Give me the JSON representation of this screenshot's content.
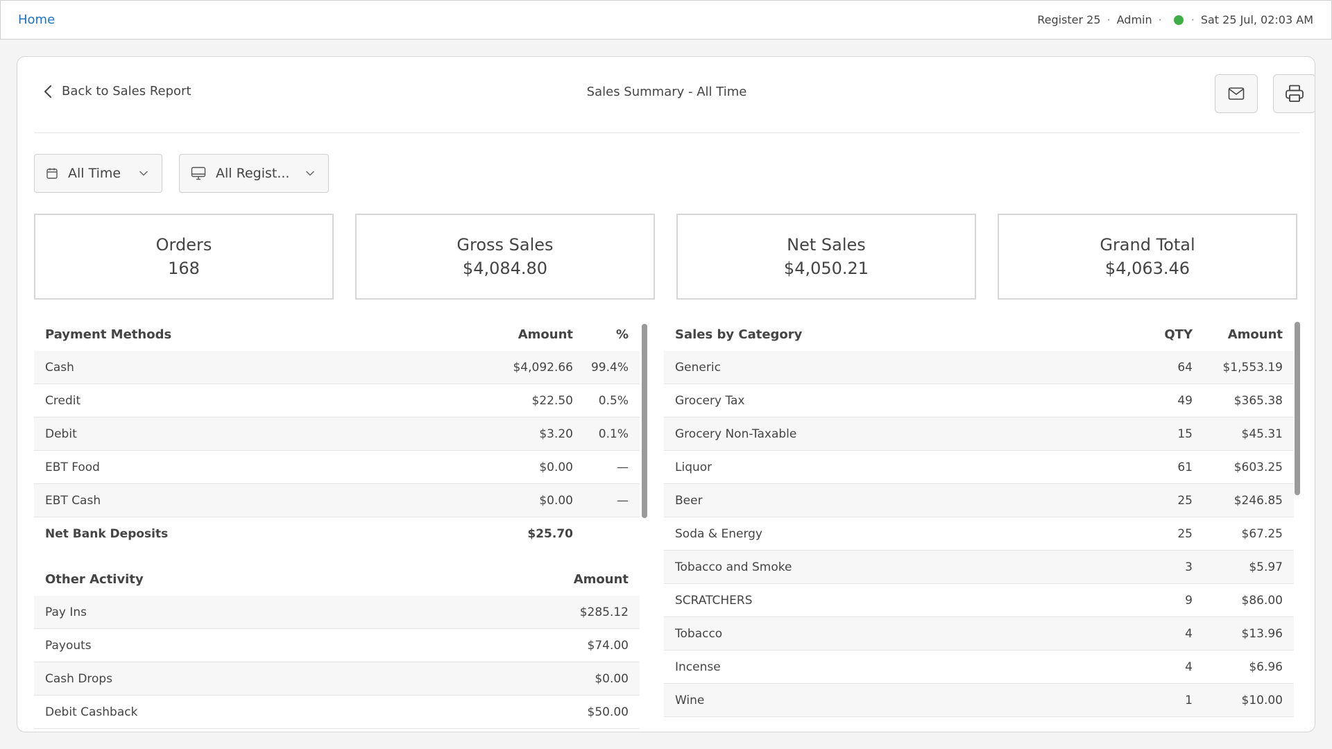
{
  "topbar": {
    "home": "Home",
    "register": "Register 25",
    "user": "Admin",
    "datetime": "Sat 25 Jul, 02:03 AM",
    "sep": "·",
    "online_color": "#3fae49"
  },
  "header": {
    "back_label": "Back to Sales Report",
    "title": "Sales Summary - All Time",
    "email_icon": "mail-icon",
    "print_icon": "printer-icon"
  },
  "filters": {
    "time": "All Time",
    "register": "All Regist..."
  },
  "summary": {
    "orders": {
      "label": "Orders",
      "value": "168"
    },
    "gross": {
      "label": "Gross Sales",
      "value": "$4,084.80"
    },
    "net": {
      "label": "Net Sales",
      "value": "$4,050.21"
    },
    "grand": {
      "label": "Grand Total",
      "value": "$4,063.46"
    }
  },
  "payment_methods": {
    "header": {
      "name": "Payment Methods",
      "amount": "Amount",
      "pct": "%"
    },
    "rows": [
      {
        "name": "Cash",
        "amount": "$4,092.66",
        "pct": "99.4%"
      },
      {
        "name": "Credit",
        "amount": "$22.50",
        "pct": "0.5%"
      },
      {
        "name": "Debit",
        "amount": "$3.20",
        "pct": "0.1%"
      },
      {
        "name": "EBT Food",
        "amount": "$0.00",
        "pct": "—"
      },
      {
        "name": "EBT Cash",
        "amount": "$0.00",
        "pct": "—"
      }
    ],
    "total": {
      "name": "Net Bank Deposits",
      "amount": "$25.70"
    }
  },
  "other_activity": {
    "header": {
      "name": "Other Activity",
      "amount": "Amount"
    },
    "rows": [
      {
        "name": "Pay Ins",
        "amount": "$285.12"
      },
      {
        "name": "Payouts",
        "amount": "$74.00"
      },
      {
        "name": "Cash Drops",
        "amount": "$0.00"
      },
      {
        "name": "Debit Cashback",
        "amount": "$50.00"
      }
    ]
  },
  "sales_by_category": {
    "header": {
      "name": "Sales by Category",
      "qty": "QTY",
      "amount": "Amount"
    },
    "rows": [
      {
        "name": "Generic",
        "qty": "64",
        "amount": "$1,553.19"
      },
      {
        "name": "Grocery Tax",
        "qty": "49",
        "amount": "$365.38"
      },
      {
        "name": "Grocery Non-Taxable",
        "qty": "15",
        "amount": "$45.31"
      },
      {
        "name": "Liquor",
        "qty": "61",
        "amount": "$603.25"
      },
      {
        "name": "Beer",
        "qty": "25",
        "amount": "$246.85"
      },
      {
        "name": "Soda & Energy",
        "qty": "25",
        "amount": "$67.25"
      },
      {
        "name": "Tobacco and Smoke",
        "qty": "3",
        "amount": "$5.97"
      },
      {
        "name": "SCRATCHERS",
        "qty": "9",
        "amount": "$86.00"
      },
      {
        "name": "Tobacco",
        "qty": "4",
        "amount": "$13.96"
      },
      {
        "name": "Incense",
        "qty": "4",
        "amount": "$6.96"
      },
      {
        "name": "Wine",
        "qty": "1",
        "amount": "$10.00"
      }
    ]
  }
}
